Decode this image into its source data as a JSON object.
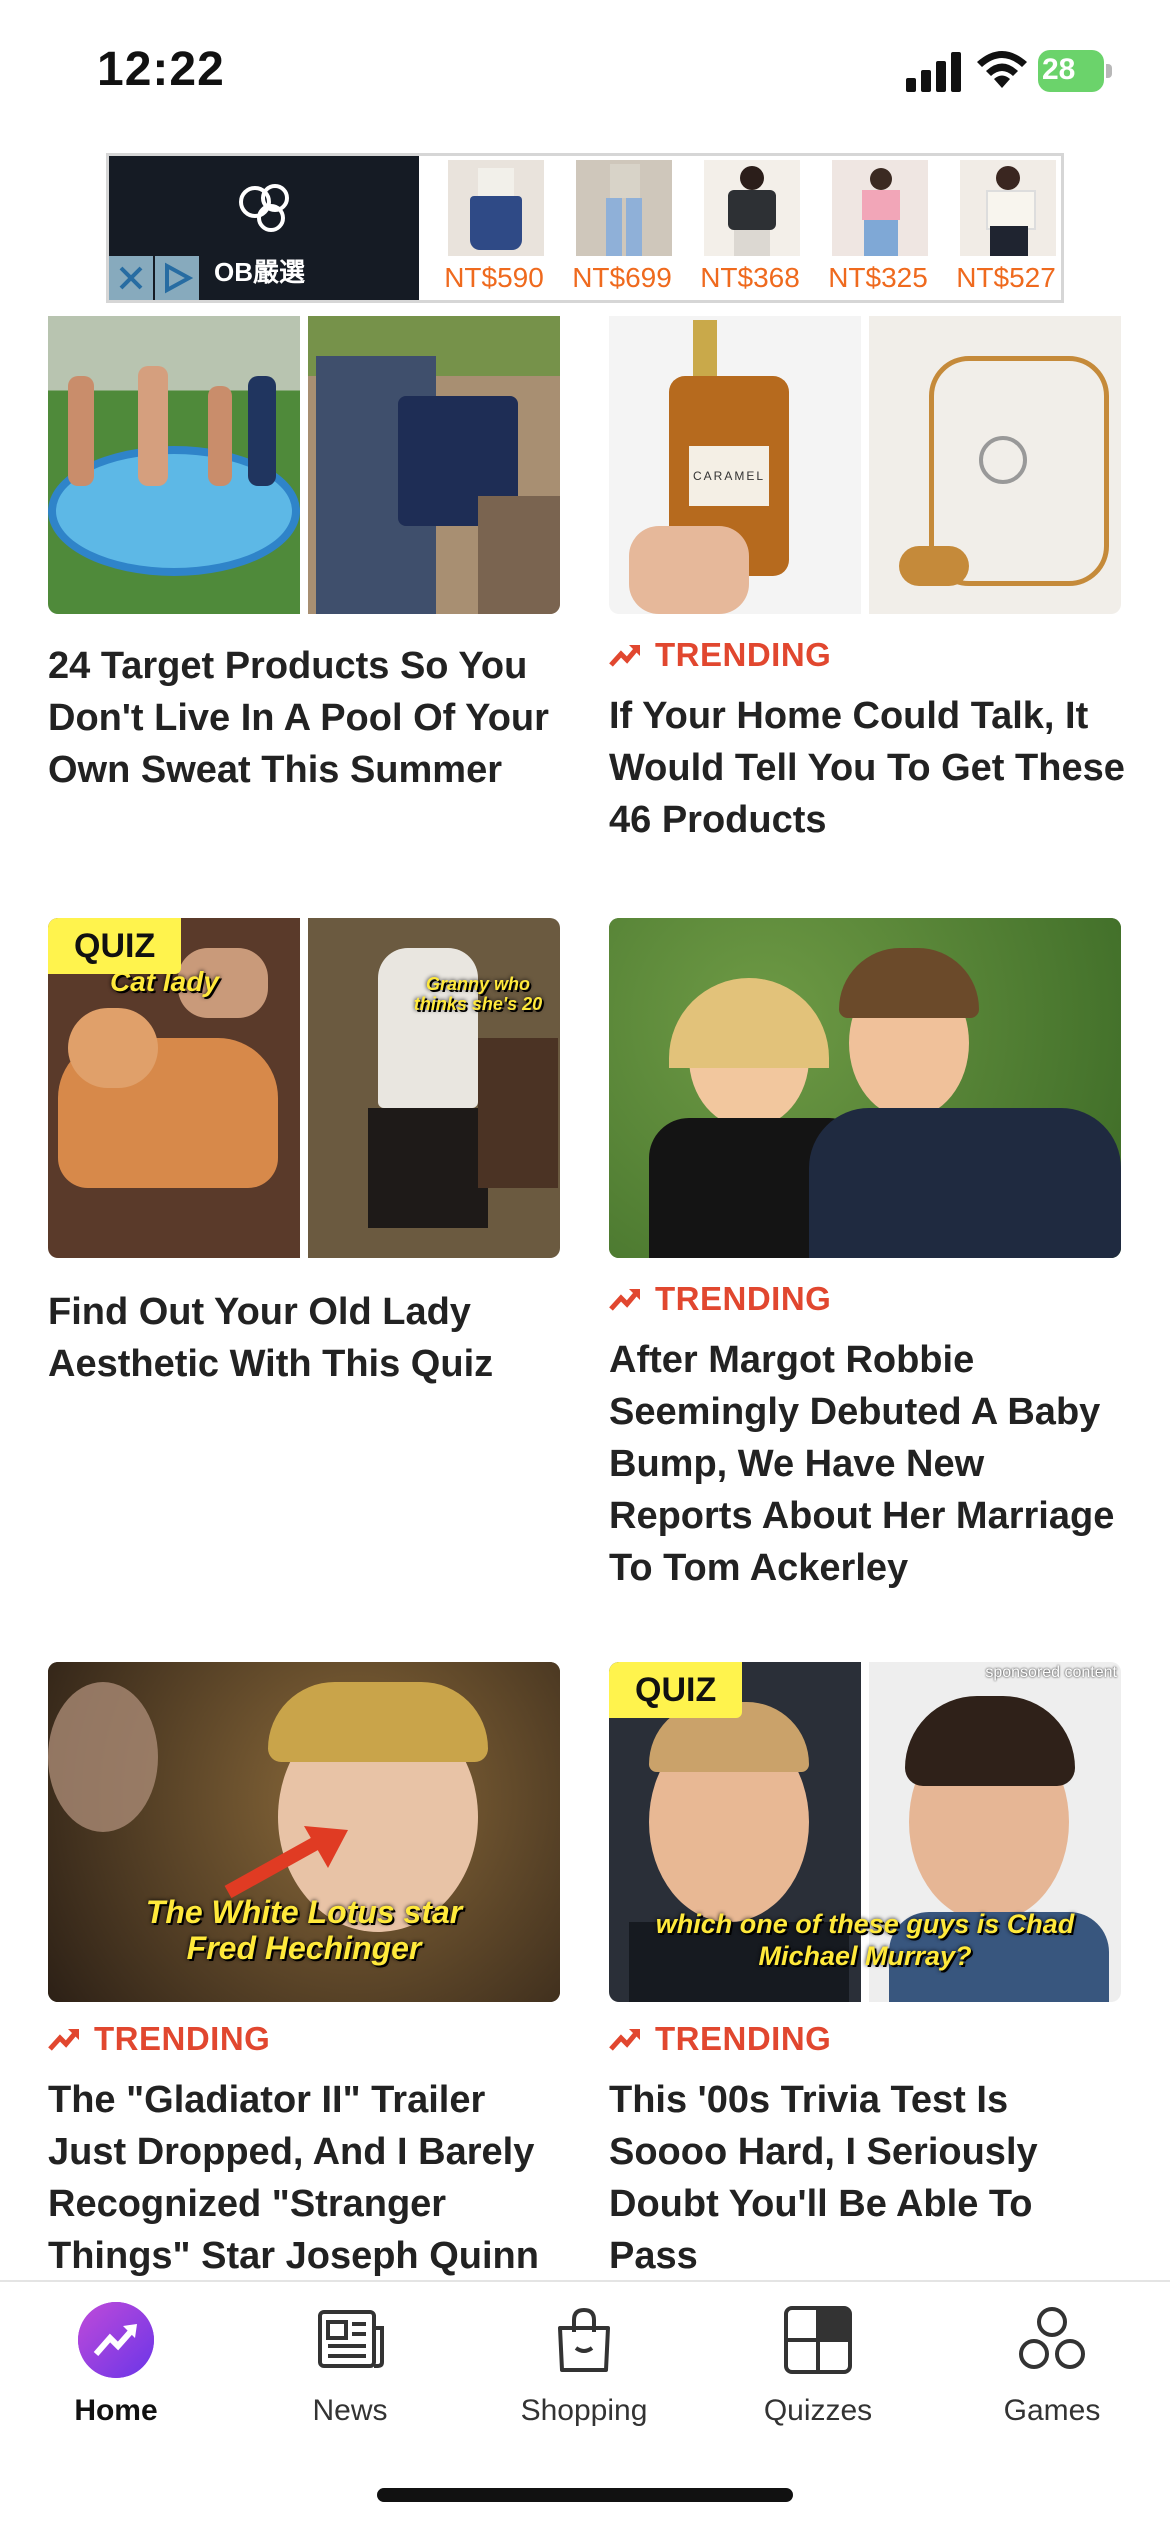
{
  "status_bar": {
    "time": "12:22",
    "battery": "28"
  },
  "ad": {
    "brand": "OB嚴選",
    "prices": [
      "NT$590",
      "NT$699",
      "NT$368",
      "NT$325",
      "NT$527"
    ]
  },
  "feed": {
    "trending_label": "TRENDING",
    "quiz_label": "QUIZ",
    "cards": [
      {
        "title": "24 Target Products So You Don't Live In A Pool Of Your Own Sweat This Summer"
      },
      {
        "title": "If Your Home Could Talk, It Would Tell You To Get These 46 Products",
        "bottle_text": "CARAMEL"
      },
      {
        "title": "Find Out Your Old Lady Aesthetic With This Quiz",
        "caption_left": "Cat lady",
        "caption_right": "Granny who thinks she's 20"
      },
      {
        "title": "After Margot Robbie Seemingly Debuted A Baby Bump, We Have New Reports About Her Marriage To Tom Ackerley"
      },
      {
        "title": "The \"Gladiator II\" Trailer Just Dropped, And I Barely Recognized \"Stranger Things\" Star Joseph Quinn",
        "caption_line1": "The White Lotus star",
        "caption_line2": "Fred Hechinger"
      },
      {
        "title": "This '00s Trivia Test Is Soooo Hard, I Seriously Doubt You'll Be Able To Pass",
        "sponsored": "sponsored content",
        "caption": "which one of these guys is Chad Michael Murray?"
      }
    ]
  },
  "tabbar": {
    "tabs": [
      {
        "label": "Home",
        "icon": "trending-arrow-icon"
      },
      {
        "label": "News",
        "icon": "newspaper-icon"
      },
      {
        "label": "Shopping",
        "icon": "shopping-bag-icon"
      },
      {
        "label": "Quizzes",
        "icon": "quiz-grid-icon"
      },
      {
        "label": "Games",
        "icon": "games-icon"
      }
    ]
  },
  "colors": {
    "accent": "#e1472f",
    "quiz_badge": "#fff34d",
    "home_icon": "#9b3ee0"
  }
}
